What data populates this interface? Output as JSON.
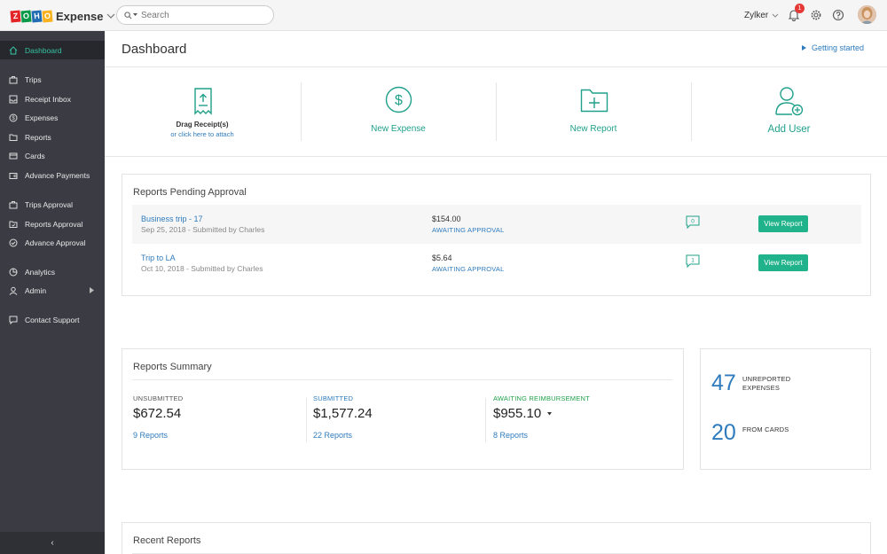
{
  "app": {
    "brand_letters": [
      "Z",
      "O",
      "H",
      "O"
    ],
    "brand_colors": [
      "#e42527",
      "#089949",
      "#226db4",
      "#f9b21d"
    ],
    "name": "Expense"
  },
  "search": {
    "placeholder": "Search"
  },
  "header": {
    "org_name": "Zylker",
    "notification_count": "1"
  },
  "sidebar": {
    "items": [
      {
        "label": "Dashboard",
        "icon": "home-icon",
        "active": true
      },
      {
        "label": "Trips",
        "icon": "suitcase-icon"
      },
      {
        "label": "Receipt Inbox",
        "icon": "inbox-icon"
      },
      {
        "label": "Expenses",
        "icon": "dollar-coin-icon"
      },
      {
        "label": "Reports",
        "icon": "folder-icon"
      },
      {
        "label": "Cards",
        "icon": "card-icon"
      },
      {
        "label": "Advance Payments",
        "icon": "wallet-icon"
      },
      {
        "label": "Trips Approval",
        "icon": "suitcase-check-icon"
      },
      {
        "label": "Reports Approval",
        "icon": "folder-check-icon"
      },
      {
        "label": "Advance Approval",
        "icon": "check-circle-icon"
      },
      {
        "label": "Analytics",
        "icon": "pie-chart-icon"
      },
      {
        "label": "Admin",
        "icon": "admin-user-icon"
      },
      {
        "label": "Contact Support",
        "icon": "chat-icon"
      }
    ],
    "collapse_glyph": "‹"
  },
  "page": {
    "title": "Dashboard",
    "getting_started": "Getting started"
  },
  "quick_actions": {
    "drag_title": "Drag Receipt(s)",
    "drag_link": "or click here to attach",
    "new_expense": "New Expense",
    "new_report": "New Report",
    "add_user": "Add User"
  },
  "pending": {
    "title": "Reports Pending Approval",
    "rows": [
      {
        "name": "Business trip - 17",
        "sub": "Sep 25, 2018 - Submitted by Charles",
        "amount": "$154.00",
        "status": "AWAITING APPROVAL",
        "comments": "0",
        "button": "View Report"
      },
      {
        "name": "Trip to LA",
        "sub": "Oct 10, 2018 - Submitted by Charles",
        "amount": "$5.64",
        "status": "AWAITING APPROVAL",
        "comments": "1",
        "button": "View Report"
      }
    ]
  },
  "summary": {
    "title": "Reports Summary",
    "columns": [
      {
        "label": "UNSUBMITTED",
        "value": "$672.54",
        "link": "9 Reports",
        "label_color": "#555555"
      },
      {
        "label": "SUBMITTED",
        "value": "$1,577.24",
        "link": "22 Reports",
        "label_color": "#2e7bbd"
      },
      {
        "label": "AWAITING REIMBURSEMENT",
        "value": "$955.10",
        "link": "8 Reports",
        "label_color": "#20a04a"
      }
    ]
  },
  "stats": {
    "unreported_count": "47",
    "unreported_label_1": "UNREPORTED",
    "unreported_label_2": "EXPENSES",
    "cards_count": "20",
    "cards_label": "FROM CARDS"
  },
  "recent": {
    "title": "Recent Reports"
  },
  "colors": {
    "accent": "#20b28a",
    "link": "#2e7bbd",
    "sidebar_bg": "#3b3c43"
  }
}
